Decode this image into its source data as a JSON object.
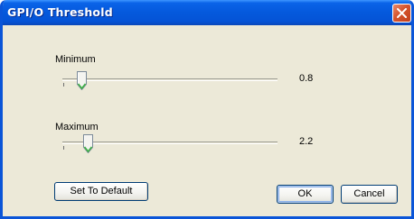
{
  "window": {
    "title": "GPI/O  Threshold"
  },
  "sliders": [
    {
      "label": "Minimum",
      "value_text": "0.8",
      "position": 0.08
    },
    {
      "label": "Maximum",
      "value_text": "2.2",
      "position": 0.11
    }
  ],
  "buttons": {
    "set_default": "Set To Default",
    "ok": "OK",
    "cancel": "Cancel"
  },
  "colors": {
    "titlebar": "#0559dc",
    "close": "#d4532d",
    "dialog_bg": "#ece9d8",
    "thumb_accent": "#3cb043"
  },
  "icons": {
    "close": "close-icon",
    "thumb": "slider-thumb-icon"
  }
}
